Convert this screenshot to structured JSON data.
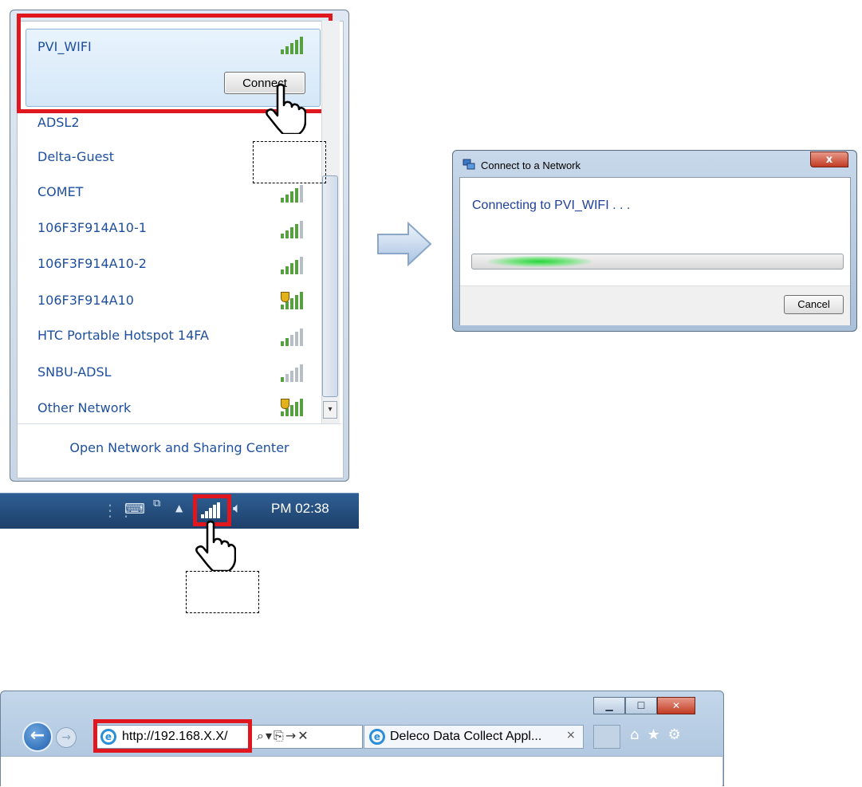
{
  "wifi_panel": {
    "selected_network": "PVI_WIFI",
    "connect_label": "Connect",
    "networks": [
      {
        "name": "ADSL2"
      },
      {
        "name": "Delta-Guest"
      },
      {
        "name": "COMET"
      },
      {
        "name": "106F3F914A10-1"
      },
      {
        "name": "106F3F914A10-2"
      },
      {
        "name": "106F3F914A10"
      },
      {
        "name": "HTC Portable Hotspot 14FA"
      },
      {
        "name": "SNBU-ADSL"
      },
      {
        "name": "Other Network"
      }
    ],
    "footer_link": "Open Network and Sharing Center"
  },
  "taskbar": {
    "clock": "PM 02:38"
  },
  "dialog": {
    "title": "Connect to a Network",
    "message": "Connecting to PVI_WIFI . . .",
    "cancel_label": "Cancel",
    "close_glyph": "x"
  },
  "browser": {
    "address": "http://192.168.X.X/",
    "tab_title": "Deleco Data Collect Appl...",
    "tab_close": "×"
  },
  "colors": {
    "highlight": "#e0171e",
    "link": "#1e4f9e",
    "signal": "#56a040"
  }
}
